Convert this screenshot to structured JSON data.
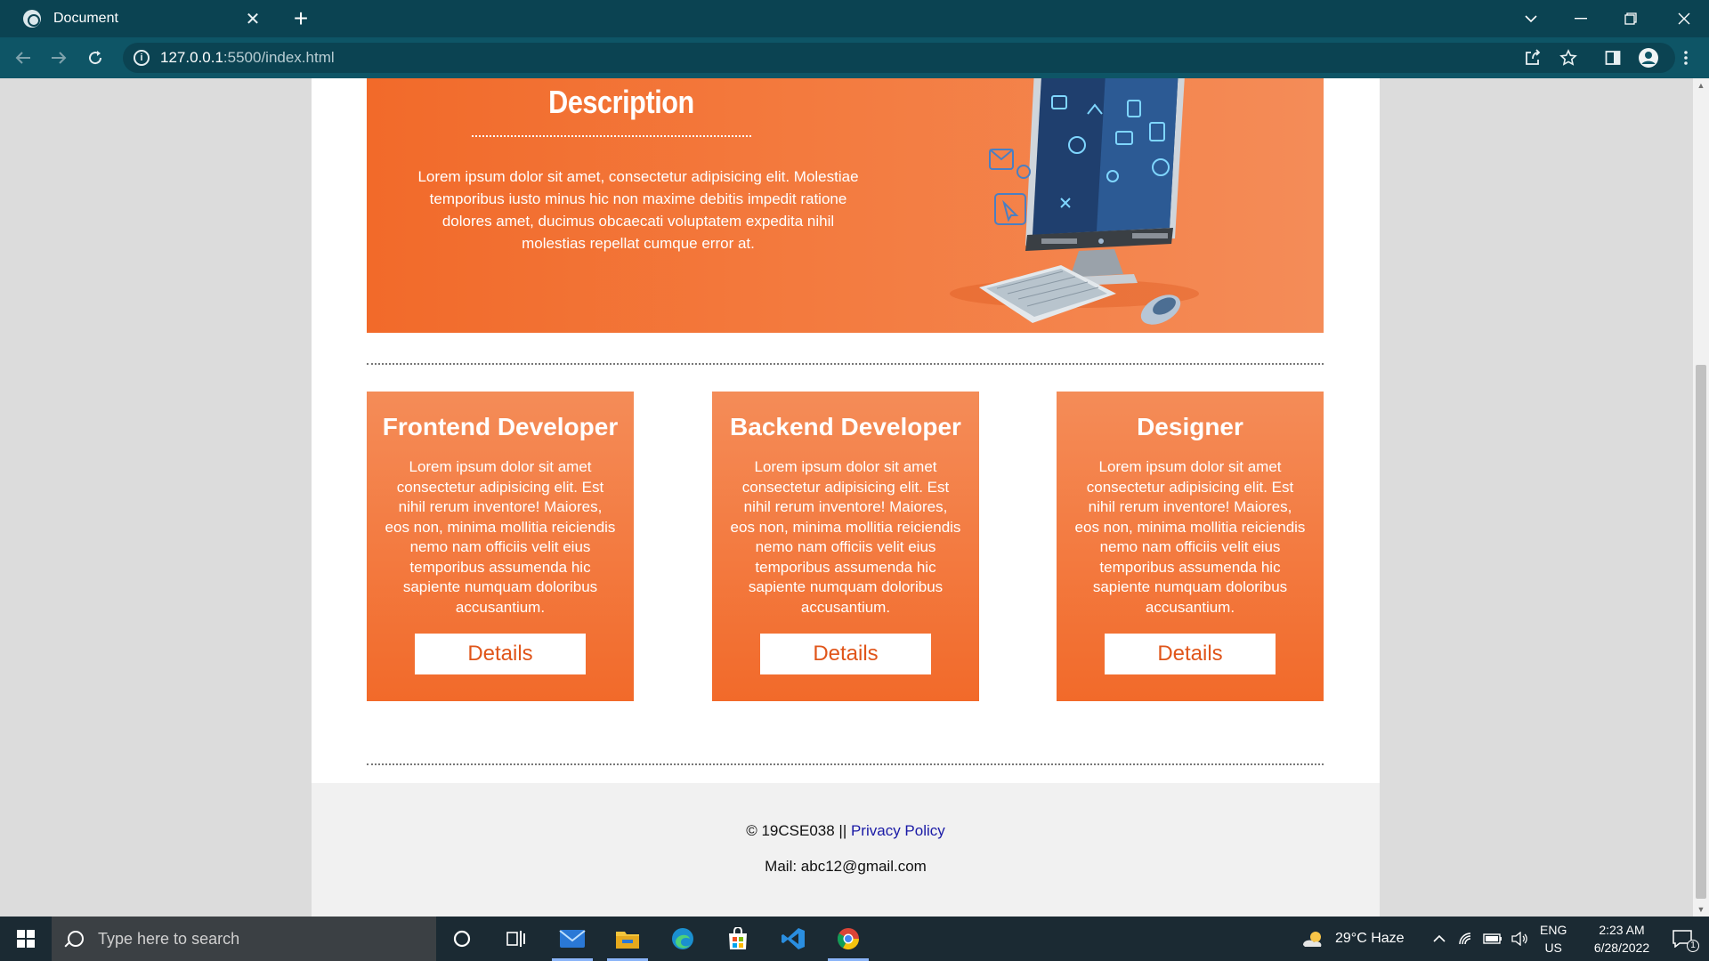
{
  "browser": {
    "tab_title": "Document",
    "close_glyph": "✕",
    "new_tab_glyph": "+",
    "url_host": "127.0.0.1",
    "url_rest": ":5500/index.html",
    "info_glyph": "i"
  },
  "hero": {
    "title": "Description",
    "text": "Lorem ipsum dolor sit amet, consectetur adipisicing elit. Molestiae temporibus iusto minus hic non maxime debitis impedit ratione dolores amet, ducimus obcaecati voluptatem expedita nihil molestias repellat cumque error at."
  },
  "cards": [
    {
      "title": "Frontend Developer",
      "text": "Lorem ipsum dolor sit amet consectetur adipisicing elit. Est nihil rerum inventore! Maiores, eos non, minima mollitia reiciendis nemo nam officiis velit eius temporibus assumenda hic sapiente numquam doloribus accusantium.",
      "button": "Details"
    },
    {
      "title": "Backend Developer",
      "text": "Lorem ipsum dolor sit amet consectetur adipisicing elit. Est nihil rerum inventore! Maiores, eos non, minima mollitia reiciendis nemo nam officiis velit eius temporibus assumenda hic sapiente numquam doloribus accusantium.",
      "button": "Details"
    },
    {
      "title": "Designer",
      "text": "Lorem ipsum dolor sit amet consectetur adipisicing elit. Est nihil rerum inventore! Maiores, eos non, minima mollitia reiciendis nemo nam officiis velit eius temporibus assumenda hic sapiente numquam doloribus accusantium.",
      "button": "Details"
    }
  ],
  "footer": {
    "copyright": "© 19CSE038 || ",
    "privacy_link": "Privacy Policy",
    "mail": "Mail: abc12@gmail.com"
  },
  "taskbar": {
    "search_placeholder": "Type here to search",
    "weather": "29°C  Haze",
    "lang_1": "ENG",
    "lang_2": "US",
    "time": "2:23 AM",
    "date": "6/28/2022",
    "notification_count": "1"
  },
  "colors": {
    "accent": "#f26a2a",
    "accent_light": "#f48c58",
    "chrome_dark": "#0b4352",
    "chrome_toolbar": "#0e5566",
    "link": "#1a1aa6"
  },
  "icons": {
    "chrome_tab_favicon": "globe-icon",
    "back": "arrow-left-icon",
    "forward": "arrow-right-icon",
    "reload": "reload-icon",
    "share": "share-icon",
    "bookmark": "star-icon",
    "side_panel": "side-panel-icon",
    "profile": "profile-icon",
    "menu": "kebab-menu-icon"
  }
}
